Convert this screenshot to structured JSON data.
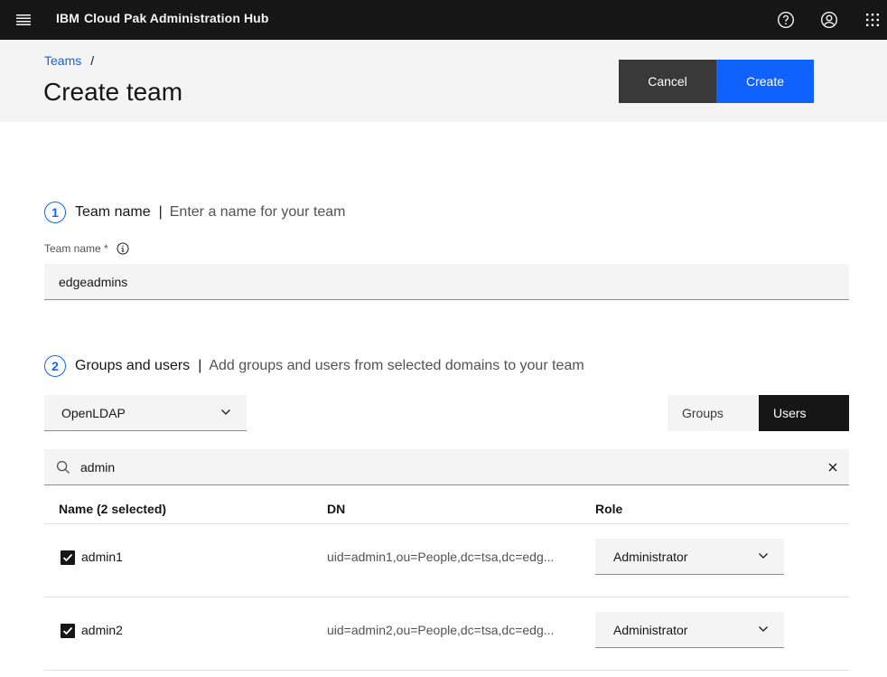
{
  "topbar": {
    "brand": "IBM",
    "product": "Cloud Pak Administration Hub",
    "icons": [
      "menu-icon",
      "help-icon",
      "user-avatar-icon",
      "app-switcher-icon"
    ]
  },
  "header": {
    "breadcrumb": {
      "link": "Teams",
      "separator": "/"
    },
    "title": "Create team",
    "cancel_label": "Cancel",
    "create_label": "Create"
  },
  "step1": {
    "number": "1",
    "title": "Team name",
    "divider": "|",
    "description": "Enter a name for your team",
    "field_label": "Team name *",
    "field_value": "edgeadmins"
  },
  "step2": {
    "number": "2",
    "title": "Groups and users",
    "divider": "|",
    "description": "Add groups and users from selected domains to your team",
    "domain_selected": "OpenLDAP",
    "switcher": {
      "groups": "Groups",
      "users": "Users",
      "active": "Users"
    },
    "search_value": "admin"
  },
  "table": {
    "headers": {
      "name": "Name (2 selected)",
      "dn": "DN",
      "role": "Role"
    },
    "rows": [
      {
        "name": "admin1",
        "dn": "uid=admin1,ou=People,dc=tsa,dc=edg...",
        "role": "Administrator",
        "checked": true
      },
      {
        "name": "admin2",
        "dn": "uid=admin2,ou=People,dc=tsa,dc=edg...",
        "role": "Administrator",
        "checked": true
      }
    ]
  },
  "colors": {
    "topbar_bg": "#161616",
    "accent": "#0f62fe",
    "secondary_button": "#393939",
    "field_bg": "#f4f4f4"
  }
}
